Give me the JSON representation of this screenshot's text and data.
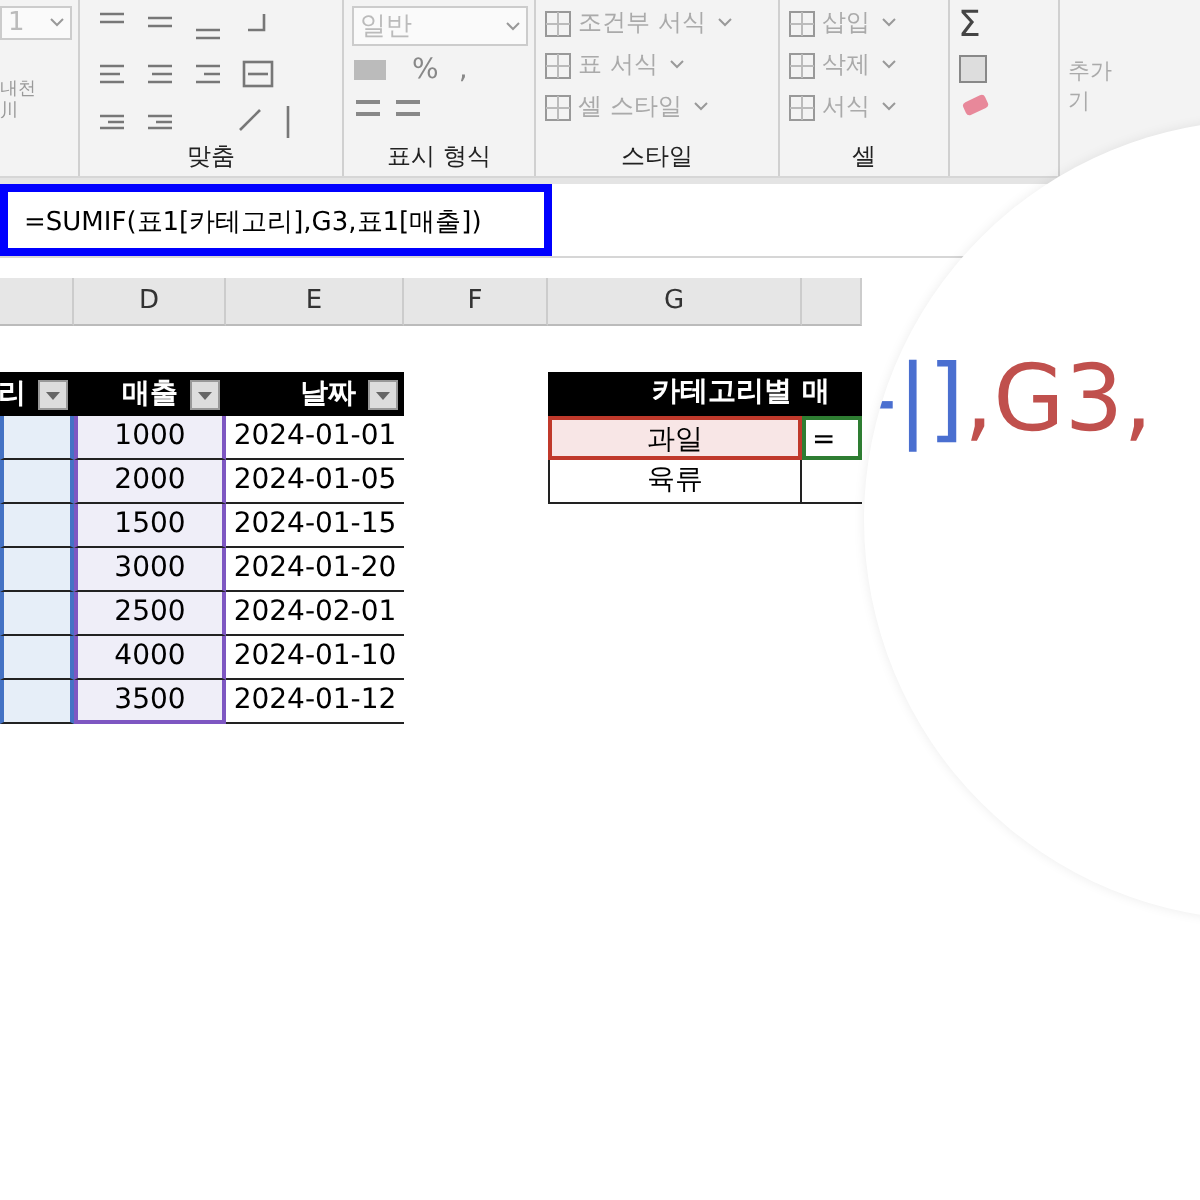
{
  "ribbon": {
    "font": {
      "size": "1",
      "phonetic": "내천",
      "phonetic_glyph": "川"
    },
    "groups": [
      {
        "kind": "align",
        "label": "맞춤"
      },
      {
        "kind": "number",
        "label": "표시 형식",
        "format": "일반",
        "percent": "%",
        "comma": ","
      },
      {
        "kind": "style",
        "label": "스타일",
        "items": [
          "조건부 서식",
          "표 서식",
          "셀 스타일"
        ]
      },
      {
        "kind": "cells",
        "label": "셀",
        "items": [
          "삽입",
          "삭제",
          "서식"
        ]
      },
      {
        "kind": "editing",
        "sigma": "Σ"
      },
      {
        "kind": "addins",
        "lines": [
          "추가",
          "기"
        ]
      }
    ]
  },
  "formula_bar": {
    "formula": "=SUMIF(표1[카테고리],G3,표1[매출])"
  },
  "column_headers": [
    "D",
    "E",
    "F",
    "G"
  ],
  "table1": {
    "columns": [
      {
        "header": "리",
        "color": "#4472c4"
      },
      {
        "header": "매출",
        "color": "#7e57c2"
      },
      {
        "header": "날짜"
      }
    ],
    "rows": [
      {
        "sales": "1000",
        "date": "2024-01-01"
      },
      {
        "sales": "2000",
        "date": "2024-01-05"
      },
      {
        "sales": "1500",
        "date": "2024-01-15"
      },
      {
        "sales": "3000",
        "date": "2024-01-20"
      },
      {
        "sales": "2500",
        "date": "2024-02-01"
      },
      {
        "sales": "4000",
        "date": "2024-01-10"
      },
      {
        "sales": "3500",
        "date": "2024-01-12"
      }
    ]
  },
  "summary": {
    "title": "카테고리별 매",
    "rows": [
      {
        "category": "과일",
        "selected": true,
        "value": "=",
        "editing": true
      },
      {
        "category": "육류",
        "selected": false
      }
    ]
  },
  "magnifier": {
    "parts": [
      {
        "text": "-|]",
        "color": "#4a6fd0"
      },
      {
        "text": ",G3,",
        "color": "#c0504d"
      }
    ]
  }
}
